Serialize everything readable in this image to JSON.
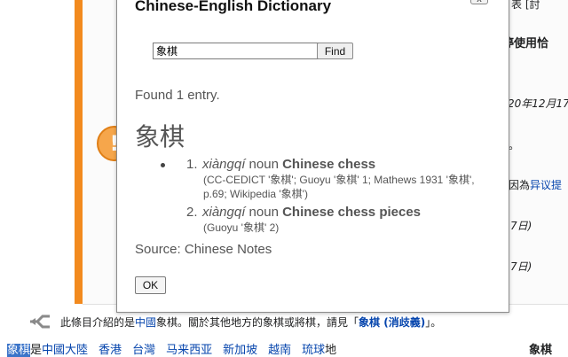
{
  "background": {
    "fragments": {
      "top_right": "表 [討",
      "heading": "停使用恰",
      "date1": "20年12月17",
      "dot": "。",
      "reason_prefix": "因為",
      "reason_link": "异议提",
      "date2": "7日)",
      "date3": "7日)"
    },
    "notice_icon": "!",
    "hatnote": {
      "prefix": "此條目介紹的是",
      "link_china": "中國",
      "middle": "象棋。關於其他地方的象棋或將棋，請見「",
      "link_disambig": "象棋 (消歧義)",
      "suffix": "」。"
    },
    "navline": {
      "highlight": "象棋",
      "after_highlight": "是",
      "links": [
        "中國大陸",
        "香港",
        "台灣",
        "马来西亚",
        "新加坡",
        "越南",
        "琉球"
      ],
      "tail": "地",
      "right_title": "象棋"
    }
  },
  "dialog": {
    "title": "Chinese-English Dictionary",
    "close_label": "x",
    "search_value": "象棋",
    "find_label": "Find",
    "found_text": "Found 1 entry.",
    "headword": "象棋",
    "senses": [
      {
        "num": "1.",
        "pinyin": "xiàngqí",
        "pos": "noun",
        "english": "Chinese chess",
        "notes": "(CC-CEDICT '象棋'; Guoyu '象棋' 1; Mathews 1931 '象棋', p.69; Wikipedia '象棋')"
      },
      {
        "num": "2.",
        "pinyin": "xiàngqí",
        "pos": "noun",
        "english": "Chinese chess pieces",
        "notes": "(Guoyu '象棋' 2)"
      }
    ],
    "source_text": "Source: Chinese Notes",
    "ok_label": "OK"
  },
  "colors": {
    "orange_bar": "#f28a1e",
    "link": "#0645ad",
    "highlight": "#3b74c9"
  }
}
